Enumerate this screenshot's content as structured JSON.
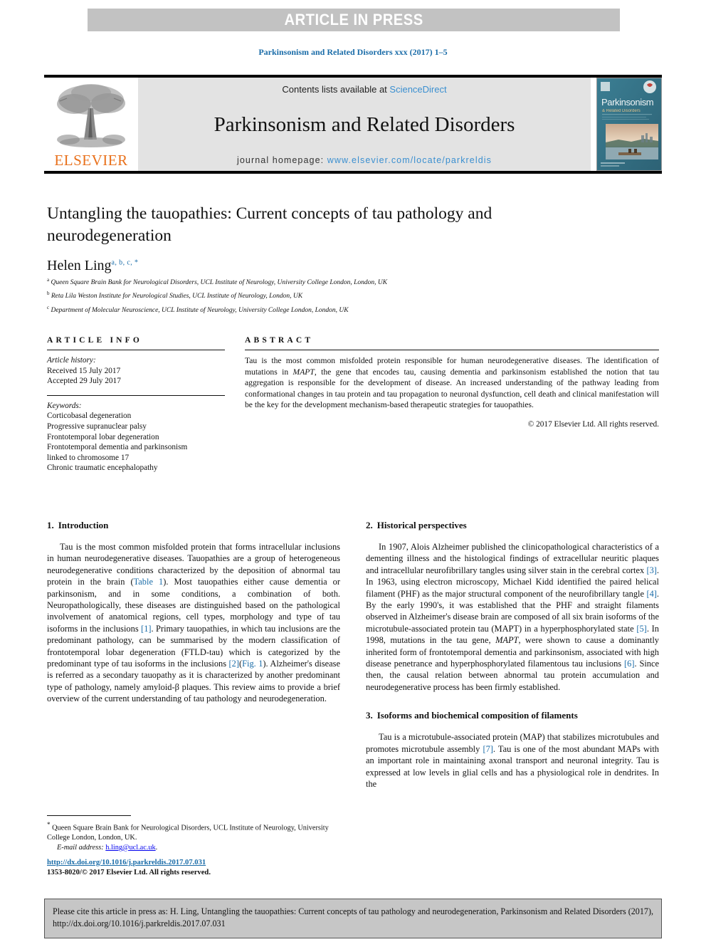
{
  "banner": {
    "text": "ARTICLE IN PRESS"
  },
  "running_head": "Parkinsonism and Related Disorders xxx (2017) 1–5",
  "masthead": {
    "contents_prefix": "Contents lists available at ",
    "contents_link": "ScienceDirect",
    "journal_title": "Parkinsonism and Related Disorders",
    "homepage_prefix": "journal homepage: ",
    "homepage_url": "www.elsevier.com/locate/parkreldis",
    "publisher": "ELSEVIER",
    "cover_title": "Parkinsonism",
    "cover_subtitle": "& Related Disorders"
  },
  "article": {
    "title": "Untangling the tauopathies: Current concepts of tau pathology and neurodegeneration",
    "author": "Helen Ling",
    "author_marks": "a, b, c, *",
    "affiliations": [
      {
        "mark": "a",
        "text": "Queen Square Brain Bank for Neurological Disorders, UCL Institute of Neurology, University College London, London, UK"
      },
      {
        "mark": "b",
        "text": "Reta Lila Weston Institute for Neurological Studies, UCL Institute of Neurology, London, UK"
      },
      {
        "mark": "c",
        "text": "Department of Molecular Neuroscience, UCL Institute of Neurology, University College London, London, UK"
      }
    ]
  },
  "article_info": {
    "label": "ARTICLE INFO",
    "history_label": "Article history:",
    "received": "Received 15 July 2017",
    "accepted": "Accepted 29 July 2017",
    "keywords_label": "Keywords:",
    "keywords": [
      "Corticobasal degeneration",
      "Progressive supranuclear palsy",
      "Frontotemporal lobar degeneration",
      "Frontotemporal dementia and parkinsonism",
      "linked to chromosome 17",
      "Chronic traumatic encephalopathy"
    ]
  },
  "abstract": {
    "label": "ABSTRACT",
    "text_parts": [
      {
        "t": "Tau is the most common misfolded protein responsible for human neurodegenerative diseases. The identification of mutations in ",
        "i": false
      },
      {
        "t": "MAPT",
        "i": true
      },
      {
        "t": ", the gene that encodes tau, causing dementia and parkinsonism established the notion that tau aggregation is responsible for the development of disease. An increased understanding of the pathway leading from conformational changes in tau protein and tau propagation to neuronal dysfunction, cell death and clinical manifestation will be the key for the development mechanism-based therapeutic strategies for tauopathies.",
        "i": false
      }
    ],
    "copyright": "© 2017 Elsevier Ltd. All rights reserved."
  },
  "sections": {
    "intro": {
      "number": "1.",
      "heading": "Introduction",
      "paragraph_parts": [
        {
          "t": "Tau is the most common misfolded protein that forms intracellular inclusions in human neurodegenerative diseases. Tauopathies are a group of heterogeneous neurodegenerative conditions characterized by the deposition of abnormal tau protein in the brain (",
          "k": "plain"
        },
        {
          "t": "Table 1",
          "k": "ref"
        },
        {
          "t": "). Most tauopathies either cause dementia or parkinsonism, and in some conditions, a combination of both. Neuropathologically, these diseases are distinguished based on the pathological involvement of anatomical regions, cell types, morphology and type of tau isoforms in the inclusions ",
          "k": "plain"
        },
        {
          "t": "[1]",
          "k": "ref"
        },
        {
          "t": ". Primary tauopathies, in which tau inclusions are the predominant pathology, can be summarised by the modern classification of frontotemporal lobar degeneration (FTLD-tau) which is categorized by the predominant type of tau isoforms in the inclusions ",
          "k": "plain"
        },
        {
          "t": "[2]",
          "k": "ref"
        },
        {
          "t": "(",
          "k": "plain"
        },
        {
          "t": "Fig. 1",
          "k": "ref"
        },
        {
          "t": "). Alzheimer's disease is referred as a secondary tauopathy as it is characterized by another predominant type of pathology, namely amyloid-β plaques. This review aims to provide a brief overview of the current understanding of tau pathology and neurodegeneration.",
          "k": "plain"
        }
      ]
    },
    "historical": {
      "number": "2.",
      "heading": "Historical perspectives",
      "paragraph_parts": [
        {
          "t": "In 1907, Alois Alzheimer published the clinicopathological characteristics of a dementing illness and the histological findings of extracellular neuritic plaques and intracellular neurofibrillary tangles using silver stain in the cerebral cortex ",
          "k": "plain"
        },
        {
          "t": "[3]",
          "k": "ref"
        },
        {
          "t": ". In 1963, using electron microscopy, Michael Kidd identified the paired helical filament (PHF) as the major structural component of the neurofibrillary tangle ",
          "k": "plain"
        },
        {
          "t": "[4]",
          "k": "ref"
        },
        {
          "t": ". By the early 1990's, it was established that the PHF and straight filaments observed in Alzheimer's disease brain are composed of all six brain isoforms of the microtubule-associated protein tau (MAPT) in a hyperphosphorylated state ",
          "k": "plain"
        },
        {
          "t": "[5]",
          "k": "ref"
        },
        {
          "t": ". In 1998, mutations in the tau gene, ",
          "k": "plain"
        },
        {
          "t": "MAPT",
          "k": "italic"
        },
        {
          "t": ", were shown to cause a dominantly inherited form of frontotemporal dementia and parkinsonism, associated with high disease penetrance and hyperphosphorylated filamentous tau inclusions ",
          "k": "plain"
        },
        {
          "t": "[6]",
          "k": "ref"
        },
        {
          "t": ". Since then, the causal relation between abnormal tau protein accumulation and neurodegenerative process has been firmly established.",
          "k": "plain"
        }
      ]
    },
    "isoforms": {
      "number": "3.",
      "heading": "Isoforms and biochemical composition of filaments",
      "paragraph_parts": [
        {
          "t": "Tau is a microtubule-associated protein (MAP) that stabilizes microtubules and promotes microtubule assembly ",
          "k": "plain"
        },
        {
          "t": "[7]",
          "k": "ref"
        },
        {
          "t": ". Tau is one of the most abundant MAPs with an important role in maintaining axonal transport and neuronal integrity. Tau is expressed at low levels in glial cells and has a physiological role in dendrites. In the",
          "k": "plain"
        }
      ]
    }
  },
  "footnote": {
    "star": "*",
    "address": "Queen Square Brain Bank for Neurological Disorders, UCL Institute of Neurology, University College London, London, UK.",
    "email_label": "E-mail address:",
    "email": "h.ling@ucl.ac.uk"
  },
  "imprint": {
    "doi": "http://dx.doi.org/10.1016/j.parkreldis.2017.07.031",
    "issn": "1353-8020/© 2017 Elsevier Ltd. All rights reserved."
  },
  "citation_footer": {
    "text": "Please cite this article in press as: H. Ling, Untangling the tauopathies: Current concepts of tau pathology and neurodegeneration, Parkinsonism and Related Disorders (2017), http://dx.doi.org/10.1016/j.parkreldis.2017.07.031"
  },
  "colors": {
    "link_blue": "#1a6ca8",
    "sd_blue": "#3a8fd0",
    "elsevier_orange": "#E9711C",
    "banner_gray": "#c2c2c2",
    "masthead_gray": "#e3e3e3",
    "footer_gray": "#c6c6c6"
  }
}
